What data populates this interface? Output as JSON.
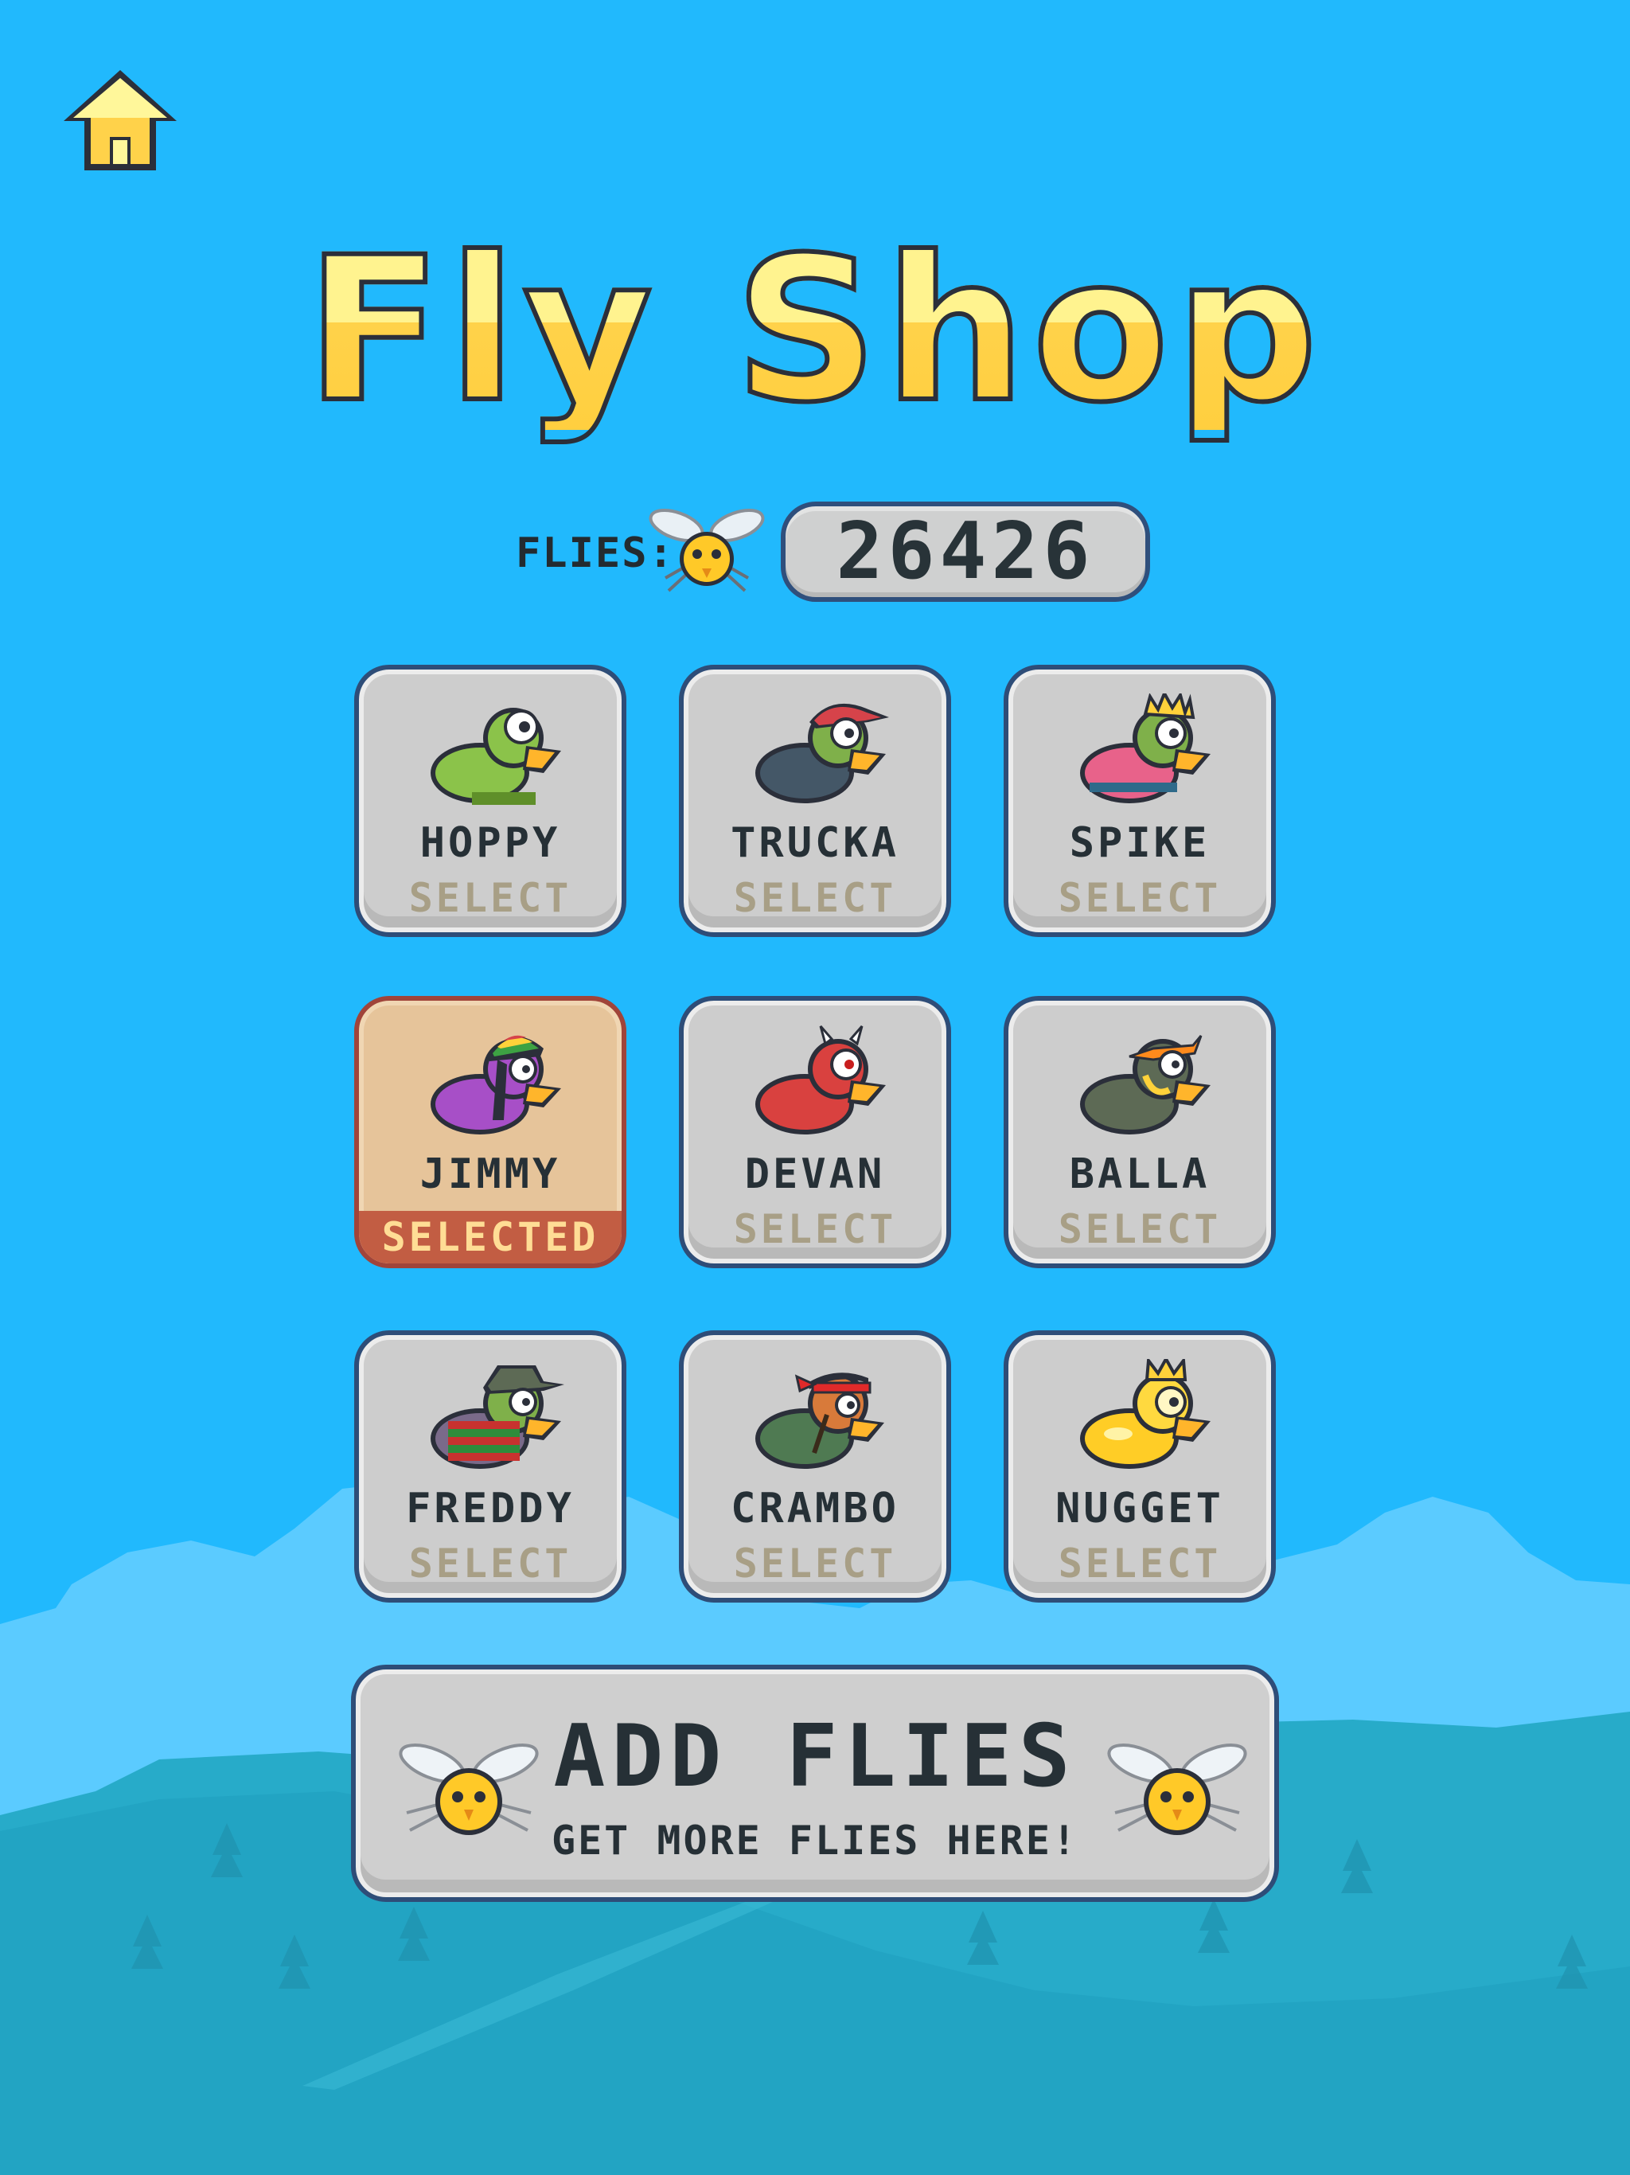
{
  "title": "Fly Shop",
  "flies": {
    "label": "FLIES:",
    "count": "26426"
  },
  "characters": [
    {
      "name": "HOPPY",
      "action": "SELECT",
      "selected": false
    },
    {
      "name": "TRUCKA",
      "action": "SELECT",
      "selected": false
    },
    {
      "name": "SPIKE",
      "action": "SELECT",
      "selected": false
    },
    {
      "name": "JIMMY",
      "action": "SELECTED",
      "selected": true
    },
    {
      "name": "DEVAN",
      "action": "SELECT",
      "selected": false
    },
    {
      "name": "BALLA",
      "action": "SELECT",
      "selected": false
    },
    {
      "name": "FREDDY",
      "action": "SELECT",
      "selected": false
    },
    {
      "name": "CRAMBO",
      "action": "SELECT",
      "selected": false
    },
    {
      "name": "NUGGET",
      "action": "SELECT",
      "selected": false
    }
  ],
  "add_flies": {
    "title": "ADD FLIES",
    "subtitle": "GET MORE FLIES  HERE!"
  },
  "colors": {
    "sky": "#21b9fd",
    "card": "#cdcdcd",
    "card_border": "#2e4d78",
    "selected_card": "#e6c49a",
    "selected_bar": "#c25d43",
    "title_yellow": "#ffd24a"
  },
  "icons": {
    "home": "home-icon",
    "fly": "fly-icon"
  }
}
